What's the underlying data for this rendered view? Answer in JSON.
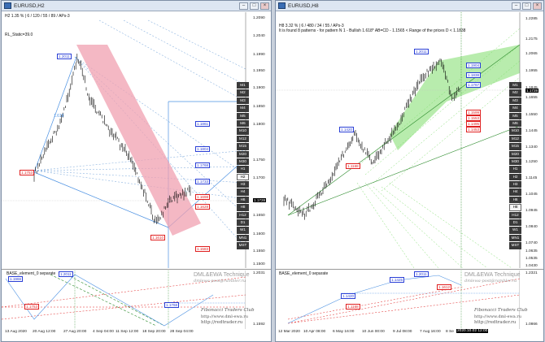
{
  "colors": {
    "bull": "#000000",
    "channel_pink": "#f0a0b0",
    "channel_green": "#7ddc6a",
    "label_blue": "#2a3fd6",
    "label_red": "#e02020"
  },
  "left": {
    "title": "EURUSD,H2",
    "info1": "H2  1.35 % | 6 / 120 / 55 / 89 / APs-3",
    "info2": "RL_Static=39.0",
    "price_axis": [
      "1.2090",
      "1.2040",
      "1.1990",
      "1.1950",
      "1.1900",
      "1.1850",
      "1.1800",
      "1.1750",
      "1.1700",
      "1.1650",
      "1.1600",
      "1.1550",
      "1.1500"
    ],
    "current_price": "1.1728",
    "labels_blue": [
      "1.2011",
      "1.1861",
      "1.1804",
      "1.1768",
      "1.1733"
    ],
    "labels_red": [
      "1.1753",
      "1.1698",
      "1.1628",
      "1.1610",
      "1.1583"
    ],
    "ratio_label": "1.618",
    "timeframes": [
      "M1",
      "M2",
      "M3",
      "M4",
      "M5",
      "M6",
      "M10",
      "M12",
      "M15",
      "M20",
      "M30",
      "H1",
      "H2",
      "H3",
      "H4",
      "H6",
      "H8",
      "H12",
      "D1",
      "W1",
      "MN1",
      "MST"
    ],
    "active_tf": "H2",
    "sub_title": "BASE_element_0 separate",
    "sub_labels_blue": [
      "1.2011",
      "1.1966",
      "1.1768"
    ],
    "sub_labels_red": [
      "1.1753"
    ],
    "sub_axis": [
      "1.2031",
      "1.1592"
    ],
    "wm_line1": "DML&EWA Technique",
    "wm_line2": "dmlewa-post@rambler.ru",
    "wm_line3": "Fibonacci Traders Club",
    "wm_line4": "http://www.dml-ewa.ru",
    "wm_line5": "http://redtrader.ru",
    "dates": [
      "13 Aug 2020",
      "20 Aug 12:00",
      "27 Aug 20:00",
      "4 Sep 04:00",
      "11 Sep 12:00",
      "18 Sep 20:00",
      "28 Sep 04:00"
    ]
  },
  "right": {
    "title": "EURUSD,H8",
    "info1": "H8  3.32 % | 6 / 480 / 34 / 55 / APs-3",
    "info2": "It is found 8 patterns  - for pattern N 1 - Bullish 1.618* AB=CD - 1.1565 < Range of the prices D < 1.1838",
    "price_axis": [
      "1.2285",
      "1.2175",
      "1.2065",
      "1.1955",
      "1.1845",
      "1.1760",
      "1.1655",
      "1.1550",
      "1.1445",
      "1.1340",
      "1.1250",
      "1.1145",
      "1.1045",
      "1.0945",
      "1.0840",
      "1.0740",
      "1.0635",
      "1.0535",
      "1.0430"
    ],
    "current_price": "1.1728",
    "labels_blue": [
      "1.2011",
      "1.1904",
      "1.1838",
      "1.1767",
      "1.1420"
    ],
    "labels_red": [
      "1.1168",
      "1.1599",
      "1.1553",
      "1.1495",
      "1.1453"
    ],
    "timeframes": [
      "M1",
      "M2",
      "M3",
      "M4",
      "M5",
      "M6",
      "M10",
      "M12",
      "M15",
      "M20",
      "M30",
      "H1",
      "H2",
      "H3",
      "H4",
      "H6",
      "H8",
      "H12",
      "D1",
      "W1",
      "MN1",
      "MST"
    ],
    "active_tf": "H8",
    "sub_title": "BASE_element_0 separate",
    "sub_labels_blue": [
      "1.2011",
      "1.1420",
      "1.1425"
    ],
    "sub_labels_red": [
      "1.1168",
      "1.1612"
    ],
    "sub_axis": [
      "1.2321",
      "1.0866"
    ],
    "wm_line1": "DML&EWA Technique",
    "wm_line2": "dmlewa-post@rambler.ru",
    "wm_line3": "Fibonacci Traders Club",
    "wm_line4": "http://www.dml-ewa.ru",
    "wm_line5": "http://redtrader.ru",
    "dates": [
      "12 Mar 2020",
      "10 Apr 08:00",
      "6 May 16:00",
      "10 Jun 00:00",
      "9 Jul 08:00",
      "7 Aug 16:00",
      "8 Se"
    ],
    "date_highlight": "2020.10.02 12:00"
  }
}
